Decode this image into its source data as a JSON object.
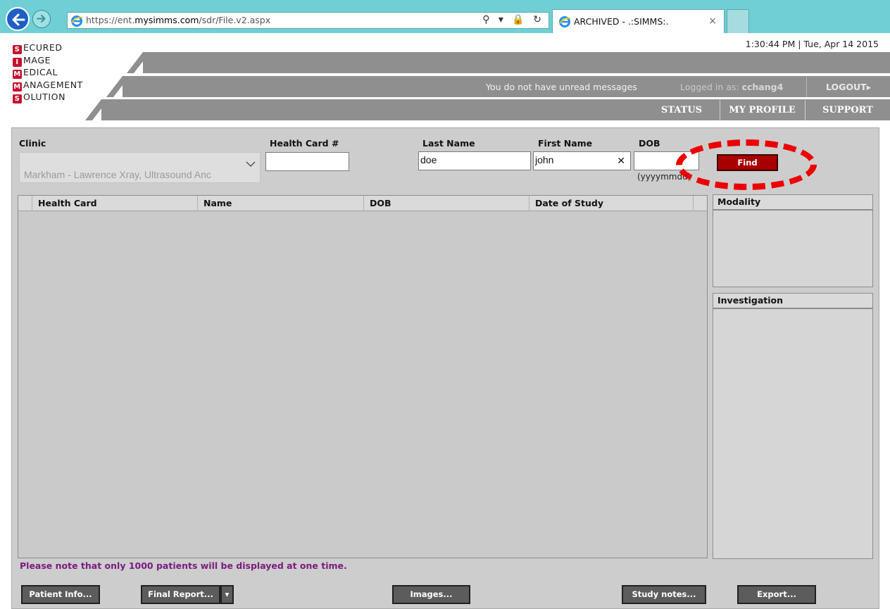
{
  "browser": {
    "url_prefix": "https://ent.",
    "url_domain": "mysimms.com",
    "url_path": "/sdr/File.v2.aspx",
    "tab_title": "ARCHIVED - .:SIMMS:.",
    "tab_close": "×",
    "address_tools": "⚲ ▾ 🔒 ↻"
  },
  "logo": {
    "lines": [
      {
        "cap": "S",
        "rest": "ECURED"
      },
      {
        "cap": "I",
        "rest": "MAGE"
      },
      {
        "cap": "M",
        "rest": "EDICAL"
      },
      {
        "cap": "M",
        "rest": "ANAGEMENT"
      },
      {
        "cap": "S",
        "rest": "OLUTION"
      }
    ]
  },
  "header": {
    "clock": "1:30:44 PM | Tue, Apr 14 2015",
    "messages": "You do not have unread messages",
    "logged_in_label": "Logged in as: ",
    "logged_in_user": "cchang4",
    "logout": "LOGOUT▸",
    "nav": {
      "status": "STATUS",
      "profile": "MY PROFILE",
      "support": "SUPPORT"
    }
  },
  "search": {
    "clinic_label": "Clinic",
    "clinic_value": "Markham - Lawrence Xray, Ultrasound Anc",
    "health_card_label": "Health Card #",
    "health_card_value": "",
    "last_name_label": "Last Name",
    "last_name_value": "doe",
    "first_name_label": "First Name",
    "first_name_value": "john",
    "clear_glyph": "✕",
    "dob_label": "DOB",
    "dob_value": "",
    "dob_hint": "(yyyymmdd)",
    "find_label": "Find"
  },
  "grid": {
    "columns": [
      "Health Card",
      "Name",
      "DOB",
      "Date of Study"
    ],
    "rows": []
  },
  "side": {
    "modality_label": "Modality",
    "investigation_label": "Investigation"
  },
  "note": "Please note that only 1000 patients will be displayed at one time.",
  "actions": {
    "patient_info": "Patient Info...",
    "final_report": "Final Report...",
    "final_report_dd": "▾",
    "images": "Images...",
    "study_notes": "Study notes...",
    "export": "Export..."
  },
  "colors": {
    "accent": "#a80000",
    "highlight": "#ee0000",
    "band": "#8f8f8f",
    "note": "#7b1b80"
  }
}
